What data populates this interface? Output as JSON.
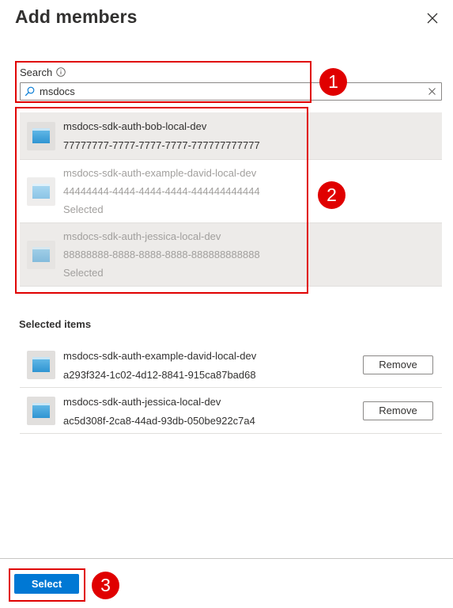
{
  "panel": {
    "title": "Add members"
  },
  "search": {
    "label": "Search",
    "value": "msdocs"
  },
  "results": [
    {
      "name": "msdocs-sdk-auth-bob-local-dev",
      "id": "77777777-7777-7777-7777-777777777777",
      "status": ""
    },
    {
      "name": "msdocs-sdk-auth-example-david-local-dev",
      "id": "44444444-4444-4444-4444-444444444444",
      "status": "Selected"
    },
    {
      "name": "msdocs-sdk-auth-jessica-local-dev",
      "id": "88888888-8888-8888-8888-888888888888",
      "status": "Selected"
    }
  ],
  "selected_items": {
    "heading": "Selected items",
    "items": [
      {
        "name": "msdocs-sdk-auth-example-david-local-dev",
        "id": "a293f324-1c02-4d12-8841-915ca87bad68",
        "remove_label": "Remove"
      },
      {
        "name": "msdocs-sdk-auth-jessica-local-dev",
        "id": "ac5d308f-2ca8-44ad-93db-050be922c7a4",
        "remove_label": "Remove"
      }
    ]
  },
  "footer": {
    "select_label": "Select"
  },
  "callouts": [
    "1",
    "2",
    "3"
  ],
  "icons": {
    "close": "close-icon",
    "info": "info-icon",
    "search": "search-icon",
    "clear": "clear-icon",
    "app": "app-registration-icon"
  },
  "colors": {
    "accent": "#0078d4",
    "callout": "#e00000",
    "row_highlight": "#edebe9"
  }
}
